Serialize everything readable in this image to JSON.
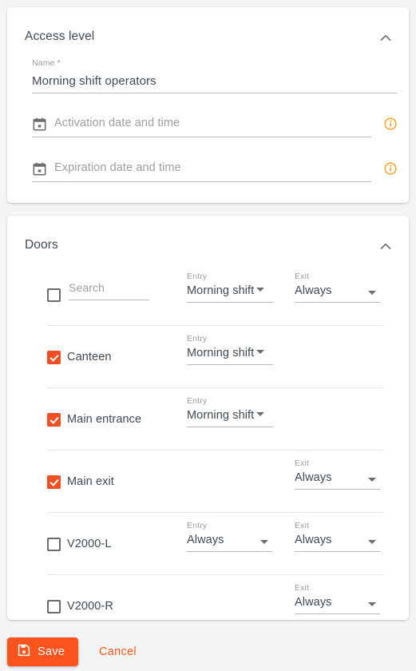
{
  "theme": {
    "accent": "#f9531e",
    "checkbox_checked": "#ef4f22",
    "info_icon": "#f7a21b",
    "text": "#3e4a56",
    "muted": "#9b9b9b",
    "page_background": "#f4f4f4",
    "card_background": "#ffffff"
  },
  "access_level": {
    "title": "Access level",
    "collapse_icon": "chevron-up-icon",
    "name_field": {
      "label": "Name *",
      "value": "Morning shift operators"
    },
    "activation": {
      "icon": "calendar-icon",
      "placeholder": "Activation date and time",
      "value": "",
      "info_icon": "info-circle-icon"
    },
    "expiration": {
      "icon": "calendar-icon",
      "placeholder": "Expiration date and time",
      "value": "",
      "info_icon": "info-circle-icon"
    }
  },
  "doors": {
    "title": "Doors",
    "collapse_icon": "chevron-up-icon",
    "columns": {
      "entry": "Entry",
      "exit": "Exit"
    },
    "header_row": {
      "checkbox_checked": false,
      "search_placeholder": "Search",
      "search_value": "",
      "entry": {
        "label": "Entry",
        "value": "Morning shift",
        "width": "auto"
      },
      "exit": {
        "label": "Exit",
        "value": "Always",
        "width": "wide"
      }
    },
    "rows": [
      {
        "name": "Canteen",
        "checked": true,
        "entry": {
          "label": "Entry",
          "value": "Morning shift",
          "width": "auto"
        },
        "exit": null
      },
      {
        "name": "Main entrance",
        "checked": true,
        "entry": {
          "label": "Entry",
          "value": "Morning shift",
          "width": "auto"
        },
        "exit": null
      },
      {
        "name": "Main exit",
        "checked": true,
        "entry": null,
        "exit": {
          "label": "Exit",
          "value": "Always",
          "width": "wide"
        }
      },
      {
        "name": "V2000-L",
        "checked": false,
        "entry": {
          "label": "Entry",
          "value": "Always",
          "width": "wide"
        },
        "exit": {
          "label": "Exit",
          "value": "Always",
          "width": "wide"
        }
      },
      {
        "name": "V2000-R",
        "checked": false,
        "entry": null,
        "exit": {
          "label": "Exit",
          "value": "Always",
          "width": "wide"
        }
      }
    ]
  },
  "footer": {
    "save_label": "Save",
    "save_icon": "save-floppy-icon",
    "cancel_label": "Cancel"
  }
}
